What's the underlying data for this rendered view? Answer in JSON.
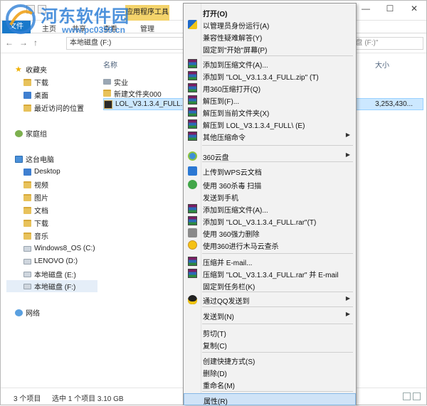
{
  "watermark": {
    "text": "河东软件园",
    "url": "www.pc0359.cn"
  },
  "titlebar": {
    "context_tab": "应用程序工具",
    "controls": [
      "—",
      "☐",
      "✕"
    ]
  },
  "ribbon": {
    "file_tab": "文件",
    "tabs": [
      "主页",
      "共享",
      "查看",
      "管理"
    ]
  },
  "address": {
    "path": "本地磁盘 (F:)",
    "search_placeholder": "搜索\"本地磁盘 (F:)\""
  },
  "nav_pane": {
    "favorites": "收藏夹",
    "favorite_items": [
      "下载",
      "桌面",
      "最近访问的位置"
    ],
    "homegroup": "家庭组",
    "this_pc": "这台电脑",
    "pc_items": [
      "Desktop",
      "视频",
      "图片",
      "文档",
      "下载",
      "音乐",
      "Windows8_OS (C:)",
      "LENOVO (D:)",
      "本地磁盘 (E:)",
      "本地磁盘 (F:)"
    ],
    "network": "网络"
  },
  "file_pane": {
    "columns": {
      "name": "名称",
      "size": "大小"
    },
    "files": [
      {
        "name": "实业",
        "size": ""
      },
      {
        "name": "新建文件夹000",
        "size": ""
      },
      {
        "name": "LOL_V3.1.3.4_FULL.exe",
        "size": "3,253,430..."
      }
    ]
  },
  "status": {
    "count": "3 个项目",
    "selected": "选中 1 个项目  3.10 GB"
  },
  "context_menu": {
    "items": [
      {
        "label": "打开(O)",
        "icon": "none"
      },
      {
        "label": "以管理员身份运行(A)",
        "icon": "shield-icon"
      },
      {
        "label": "兼容性疑难解答(Y)",
        "icon": "none"
      },
      {
        "label": "固定到\"开始\"屏幕(P)",
        "icon": "none"
      },
      {
        "label": "添加到压缩文件(A)...",
        "icon": "winrar-icon"
      },
      {
        "label": "添加到 \"LOL_V3.1.3.4_FULL.zip\" (T)",
        "icon": "winrar-icon"
      },
      {
        "label": "用360压缩打开(Q)",
        "icon": "winrar-icon"
      },
      {
        "label": "解压到(F)...",
        "icon": "winrar-icon"
      },
      {
        "label": "解压到当前文件夹(X)",
        "icon": "winrar-icon"
      },
      {
        "label": "解压到 LOL_V3.1.3.4_FULL\\ (E)",
        "icon": "winrar-icon"
      },
      {
        "label": "其他压缩命令",
        "icon": "winrar-icon"
      },
      {
        "label": "360云盘",
        "icon": "cloud-icon"
      },
      {
        "label": "上传到WPS云文档",
        "icon": "wps-icon"
      },
      {
        "label": "使用 360杀毒 扫描",
        "icon": "antivirus-icon"
      },
      {
        "label": "发送到手机",
        "icon": "none"
      },
      {
        "label": "添加到压缩文件(A)...",
        "icon": "winrar-icon"
      },
      {
        "label": "添加到 \"LOL_V3.1.3.4_FULL.rar\"(T)",
        "icon": "winrar-icon"
      },
      {
        "label": "使用 360强力删除",
        "icon": "shredder-icon"
      },
      {
        "label": "使用360进行木马云查杀",
        "icon": "trojan-scan-icon"
      },
      {
        "label": "压缩并 E-mail...",
        "icon": "winrar-icon"
      },
      {
        "label": "压缩到 \"LOL_V3.1.3.4_FULL.rar\" 并 E-mail",
        "icon": "winrar-icon"
      },
      {
        "label": "固定到任务栏(K)",
        "icon": "none"
      },
      {
        "label": "通过QQ发送到",
        "icon": "qq-icon"
      },
      {
        "label": "发送到(N)",
        "icon": "none"
      },
      {
        "label": "剪切(T)",
        "icon": "none"
      },
      {
        "label": "复制(C)",
        "icon": "none"
      },
      {
        "label": "创建快捷方式(S)",
        "icon": "none"
      },
      {
        "label": "删除(D)",
        "icon": "none"
      },
      {
        "label": "重命名(M)",
        "icon": "none"
      },
      {
        "label": "属性(R)",
        "icon": "none"
      }
    ]
  },
  "colors": {
    "menu_bg": "#f2f2f2",
    "highlight": "#cfe3f7",
    "accent": "#1979ca",
    "context_tab": "#f4d36b"
  }
}
